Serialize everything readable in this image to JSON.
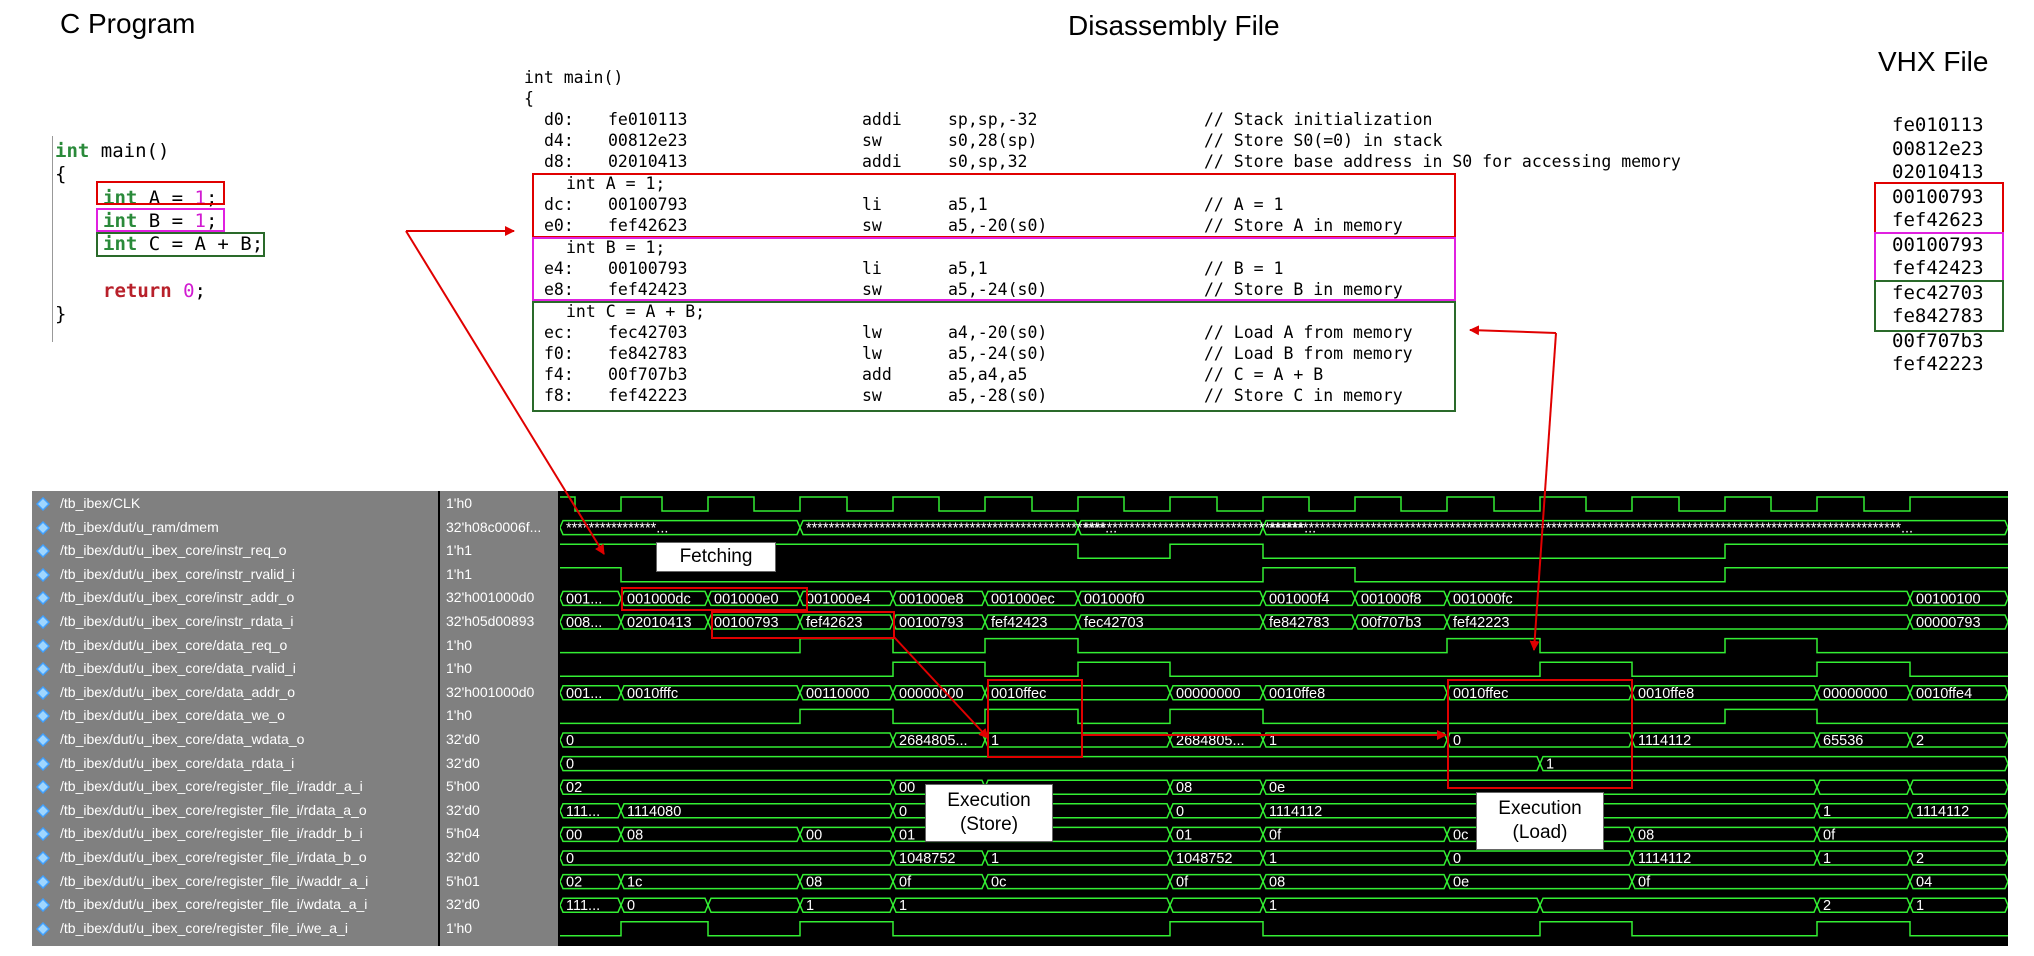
{
  "titles": {
    "c_program": "C Program",
    "disassembly": "Disassembly File",
    "vhx": "VHX File"
  },
  "c_program": {
    "l1_kw": "int",
    "l1_rest": " main()",
    "l2": "{",
    "a_kw": "int",
    "a_mid": " A = ",
    "a_num": "1",
    "a_end": ";",
    "b_kw": "int",
    "b_mid": " B = ",
    "b_num": "1",
    "b_end": ";",
    "c_kw": "int",
    "c_rest": " C = A + B;",
    "ret_kw": "return",
    "ret_sp": " ",
    "ret_num": "0",
    "ret_end": ";",
    "close": "}"
  },
  "disassembly": {
    "header1": "int main()",
    "header2": "{",
    "src_a": "int A = 1;",
    "src_b": "int B = 1;",
    "src_c": "int C = A + B;",
    "rows": [
      {
        "addr": "d0:",
        "code": "fe010113",
        "op": "addi",
        "args": "sp,sp,-32",
        "cmt": "// Stack initialization"
      },
      {
        "addr": "d4:",
        "code": "00812e23",
        "op": "sw",
        "args": "s0,28(sp)",
        "cmt": "// Store S0(=0) in stack"
      },
      {
        "addr": "d8:",
        "code": "02010413",
        "op": "addi",
        "args": "s0,sp,32",
        "cmt": "// Store base address in S0 for accessing memory"
      },
      {
        "addr": "dc:",
        "code": "00100793",
        "op": "li",
        "args": "a5,1",
        "cmt": "// A = 1"
      },
      {
        "addr": "e0:",
        "code": "fef42623",
        "op": "sw",
        "args": "a5,-20(s0)",
        "cmt": "// Store A in memory"
      },
      {
        "addr": "e4:",
        "code": "00100793",
        "op": "li",
        "args": "a5,1",
        "cmt": "// B = 1"
      },
      {
        "addr": "e8:",
        "code": "fef42423",
        "op": "sw",
        "args": "a5,-24(s0)",
        "cmt": "// Store B in memory"
      },
      {
        "addr": "ec:",
        "code": "fec42703",
        "op": "lw",
        "args": "a4,-20(s0)",
        "cmt": "// Load A from memory"
      },
      {
        "addr": "f0:",
        "code": "fe842783",
        "op": "lw",
        "args": "a5,-24(s0)",
        "cmt": "// Load B from memory"
      },
      {
        "addr": "f4:",
        "code": "00f707b3",
        "op": "add",
        "args": "a5,a4,a5",
        "cmt": "// C = A + B"
      },
      {
        "addr": "f8:",
        "code": "fef42223",
        "op": "sw",
        "args": "a5,-28(s0)",
        "cmt": "// Store C in memory"
      }
    ]
  },
  "vhx": [
    "fe010113",
    "00812e23",
    "02010413",
    "00100793",
    "fef42623",
    "00100793",
    "fef42423",
    "fec42703",
    "fe842783",
    "00f707b3",
    "fef42223"
  ],
  "signals": [
    {
      "name": "/tb_ibex/CLK",
      "value": "1'h0"
    },
    {
      "name": "/tb_ibex/dut/u_ram/dmem",
      "value": "32'h08c0006f..."
    },
    {
      "name": "/tb_ibex/dut/u_ibex_core/instr_req_o",
      "value": "1'h1"
    },
    {
      "name": "/tb_ibex/dut/u_ibex_core/instr_rvalid_i",
      "value": "1'h1"
    },
    {
      "name": "/tb_ibex/dut/u_ibex_core/instr_addr_o",
      "value": "32'h001000d0"
    },
    {
      "name": "/tb_ibex/dut/u_ibex_core/instr_rdata_i",
      "value": "32'h05d00893"
    },
    {
      "name": "/tb_ibex/dut/u_ibex_core/data_req_o",
      "value": "1'h0"
    },
    {
      "name": "/tb_ibex/dut/u_ibex_core/data_rvalid_i",
      "value": "1'h0"
    },
    {
      "name": "/tb_ibex/dut/u_ibex_core/data_addr_o",
      "value": "32'h001000d0"
    },
    {
      "name": "/tb_ibex/dut/u_ibex_core/data_we_o",
      "value": "1'h0"
    },
    {
      "name": "/tb_ibex/dut/u_ibex_core/data_wdata_o",
      "value": "32'd0"
    },
    {
      "name": "/tb_ibex/dut/u_ibex_core/data_rdata_i",
      "value": "32'd0"
    },
    {
      "name": "/tb_ibex/dut/u_ibex_core/register_file_i/raddr_a_i",
      "value": "5'h00"
    },
    {
      "name": "/tb_ibex/dut/u_ibex_core/register_file_i/rdata_a_o",
      "value": "32'd0"
    },
    {
      "name": "/tb_ibex/dut/u_ibex_core/register_file_i/raddr_b_i",
      "value": "5'h04"
    },
    {
      "name": "/tb_ibex/dut/u_ibex_core/register_file_i/rdata_b_o",
      "value": "32'd0"
    },
    {
      "name": "/tb_ibex/dut/u_ibex_core/register_file_i/waddr_a_i",
      "value": "5'h01"
    },
    {
      "name": "/tb_ibex/dut/u_ibex_core/register_file_i/wdata_a_i",
      "value": "32'd0"
    },
    {
      "name": "/tb_ibex/dut/u_ibex_core/register_file_i/we_a_i",
      "value": "1'h0"
    }
  ],
  "bus_values": {
    "dmem": [
      "****************...",
      "*****************************************************...",
      "***************************************...",
      "****************************************************************************************************************..."
    ],
    "instr_addr": [
      "001...",
      "001000dc",
      "001000e0",
      "001000e4",
      "001000e8",
      "001000ec",
      "001000f0",
      "001000f4",
      "001000f8",
      "001000fc",
      "00100100"
    ],
    "instr_rdata": [
      "008...",
      "02010413",
      "00100793",
      "fef42623",
      "00100793",
      "fef42423",
      "fec42703",
      "fe842783",
      "00f707b3",
      "fef42223",
      "00000793"
    ],
    "data_addr": [
      "001...",
      "0010fffc",
      "00110000",
      "00000000",
      "0010ffec",
      "00000000",
      "0010ffe8",
      "0010ffec",
      "0010ffe8",
      "00000000",
      "0010ffe4"
    ],
    "data_wdata": [
      "0",
      "2684805...",
      "1",
      "2684805...",
      "1",
      "0",
      "1114112",
      "65536",
      "2"
    ],
    "data_rdata": [
      "0",
      "1"
    ],
    "raddr_a": [
      "02",
      "00",
      "00",
      "08",
      "0e",
      "08"
    ],
    "rdata_a": [
      "111...",
      "1114080",
      "0",
      "0",
      "1114112",
      "1",
      "1114112"
    ],
    "raddr_b": [
      "00",
      "08",
      "00",
      "01",
      "01",
      "0f",
      "0c",
      "08",
      "0f"
    ],
    "rdata_b": [
      "0",
      "1048752",
      "1",
      "1048752",
      "1",
      "0",
      "1114112",
      "1",
      "2"
    ],
    "waddr_a": [
      "02",
      "1c",
      "08",
      "0f",
      "0c",
      "0f",
      "08",
      "0e",
      "0f",
      "04"
    ],
    "wdata_a": [
      "111...",
      "0",
      "1114112",
      "1",
      "1",
      "1",
      "2",
      "1"
    ]
  },
  "callouts": {
    "fetching": "Fetching",
    "exec_store_1": "Execution",
    "exec_store_2": "(Store)",
    "exec_load_1": "Execution",
    "exec_load_2": "(Load)"
  },
  "colors": {
    "box_a": "#e00000",
    "box_b": "#e020e0",
    "box_c": "#2a6a2a",
    "arrow": "#e00000",
    "wave_green": "#33ee33",
    "wave_bg": "#000000",
    "panel_gray": "#808080"
  }
}
